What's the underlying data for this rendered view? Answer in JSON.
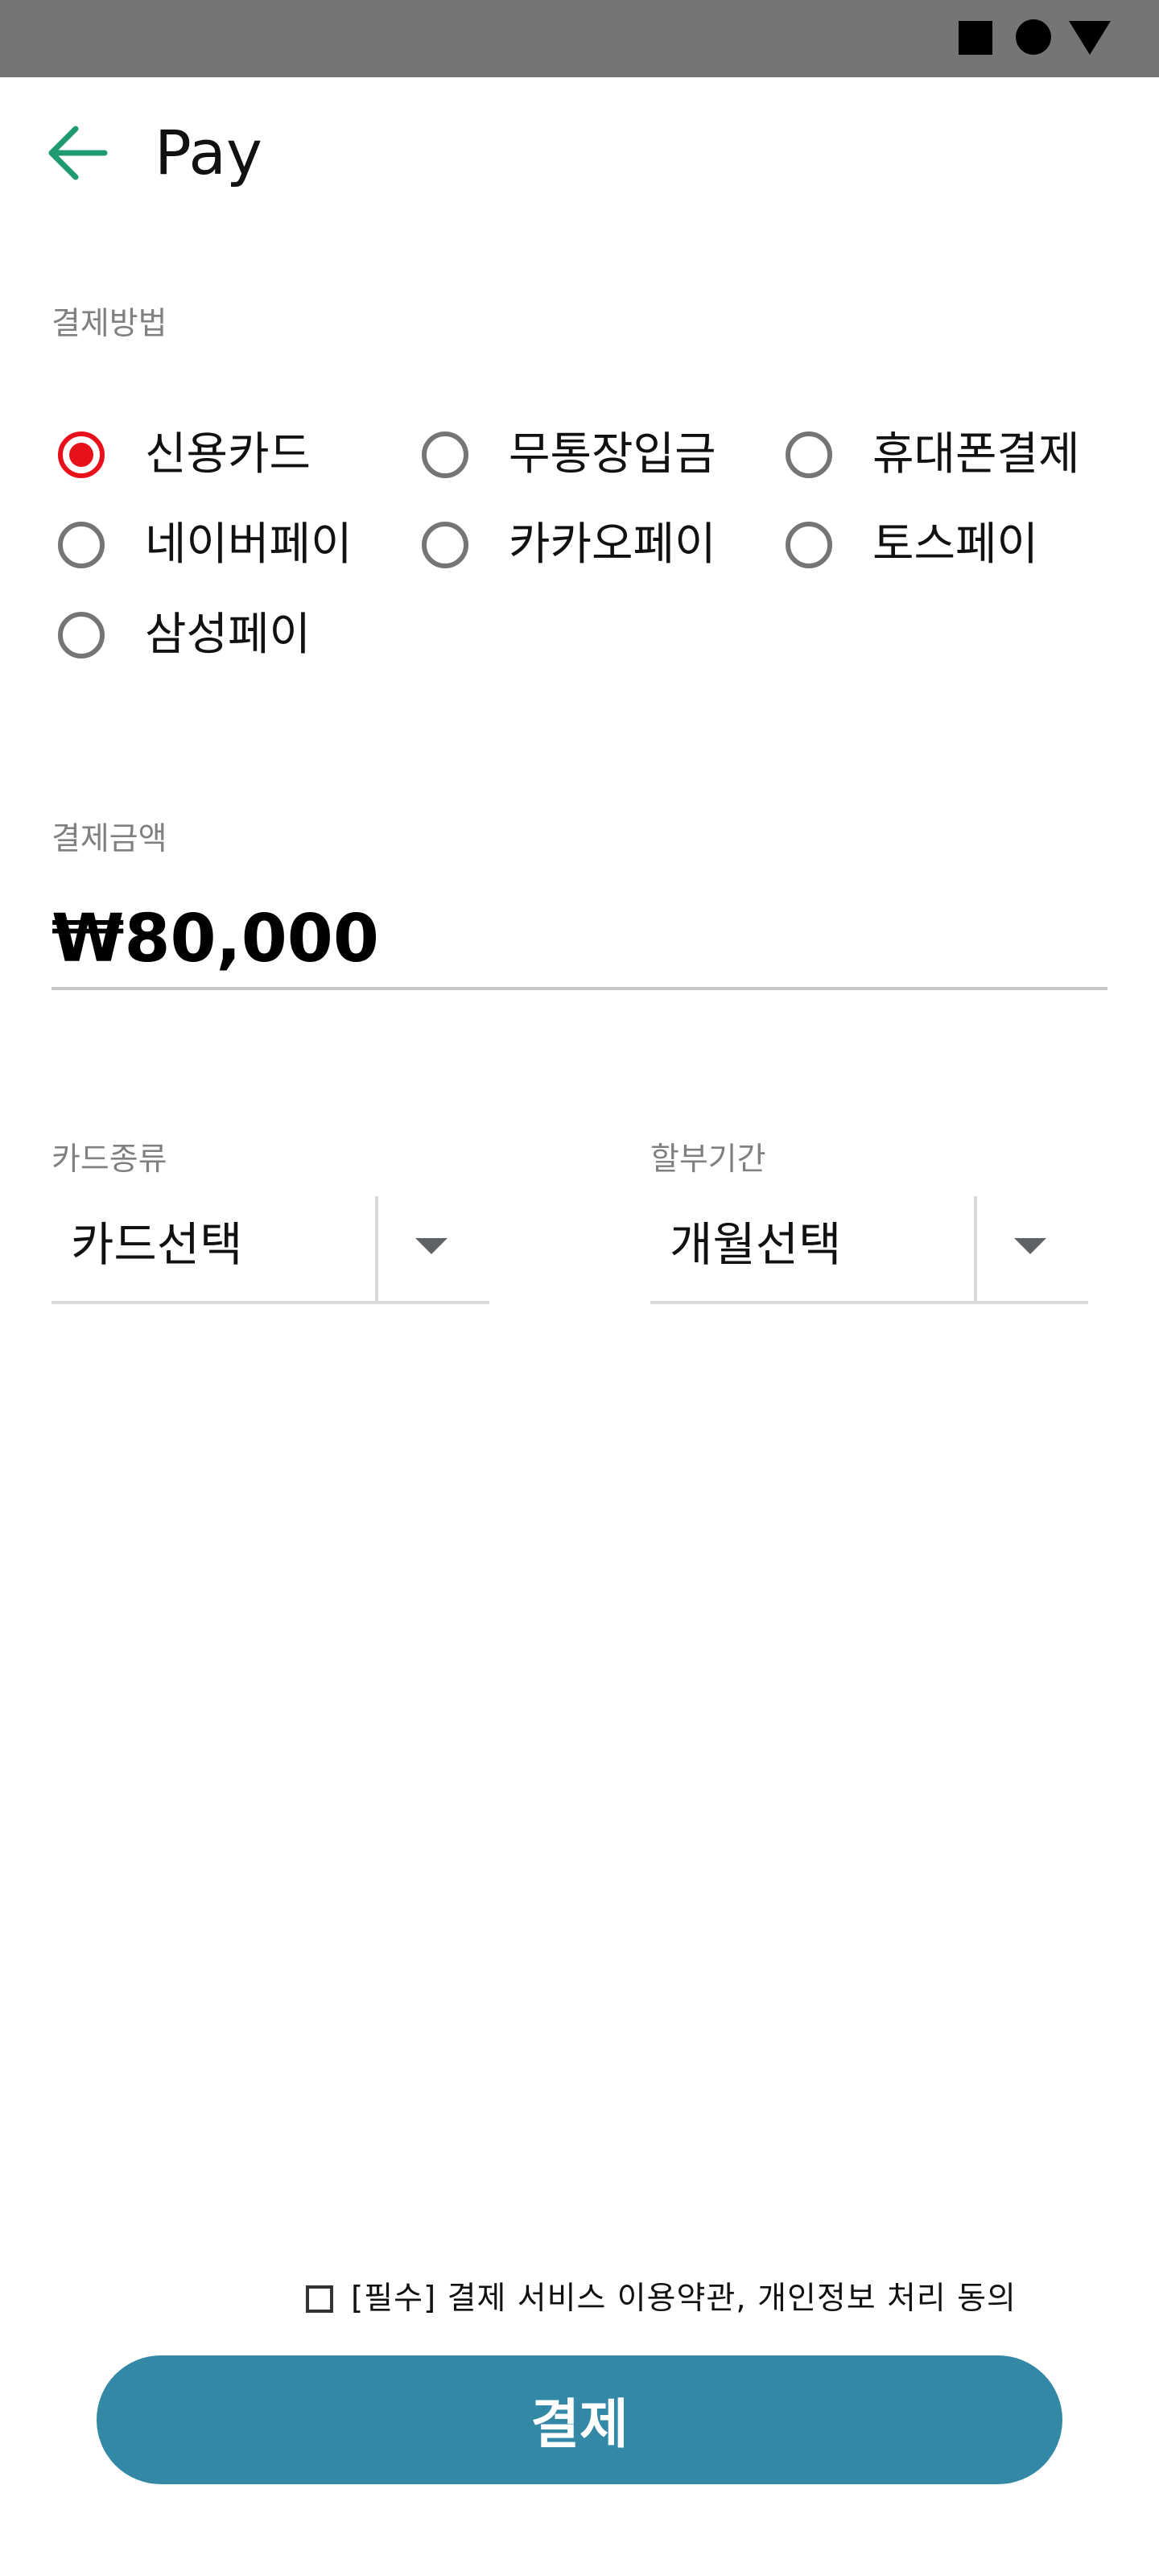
{
  "app_bar": {
    "title": "Pay",
    "back_icon": "arrow-left-icon",
    "accent_color": "#1f9b6f"
  },
  "status_bar": {
    "icons": [
      "square-icon",
      "circle-icon",
      "triangle-icon"
    ]
  },
  "payment_method": {
    "label": "결제방법",
    "options": [
      {
        "label": "신용카드",
        "selected": true
      },
      {
        "label": "무통장입금",
        "selected": false
      },
      {
        "label": "휴대폰결제",
        "selected": false
      },
      {
        "label": "네이버페이",
        "selected": false
      },
      {
        "label": "카카오페이",
        "selected": false
      },
      {
        "label": "토스페이",
        "selected": false
      },
      {
        "label": "삼성페이",
        "selected": false
      }
    ],
    "selected_color": "#e8101b"
  },
  "amount": {
    "label": "결제금액",
    "value": "₩80,000"
  },
  "card_type": {
    "label": "카드종류",
    "value": "카드선택"
  },
  "installment": {
    "label": "할부기간",
    "value": "개월선택"
  },
  "agreement": {
    "text": "[필수]  결제 서비스 이용약관, 개인정보 처리 동의",
    "checked": false
  },
  "pay_button": {
    "label": "결제",
    "color": "#3388a6"
  }
}
